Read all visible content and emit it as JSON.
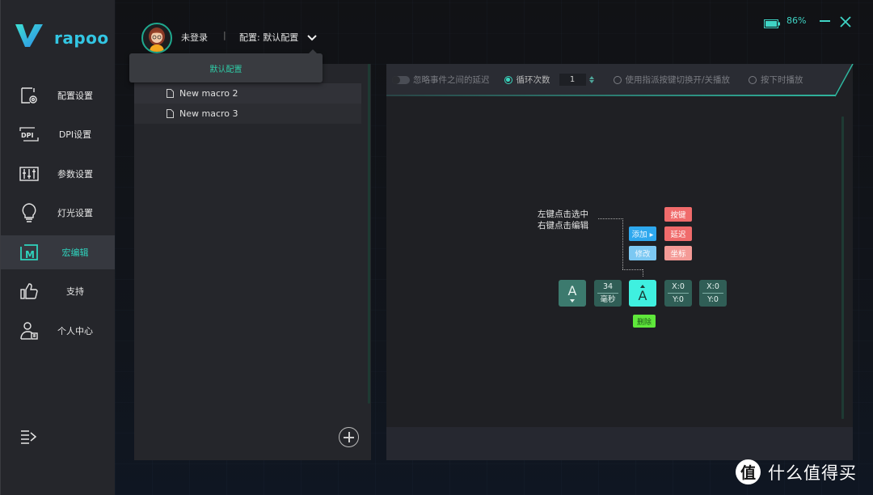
{
  "app": {
    "brand": "rapoo",
    "battery_percent": "86%",
    "battery_level": 0.86,
    "colors": {
      "accent": "#2fd3bd",
      "brand_blue": "#33c6e3",
      "battery": "#3fd4c5"
    }
  },
  "header": {
    "user_status": "未登录",
    "separator": "|",
    "config_label": "配置: 默认配置",
    "dropdown_options": [
      "默认配置"
    ]
  },
  "sidebar": {
    "items": [
      {
        "label": "配置设置",
        "icon": "profile-settings-icon",
        "active": false
      },
      {
        "label": "DPI设置",
        "icon": "dpi-icon",
        "active": false
      },
      {
        "label": "参数设置",
        "icon": "sliders-icon",
        "active": false
      },
      {
        "label": "灯光设置",
        "icon": "lightbulb-icon",
        "active": false
      },
      {
        "label": "宏编辑",
        "icon": "macro-icon",
        "active": true
      },
      {
        "label": "支持",
        "icon": "thumbs-up-icon",
        "active": false
      },
      {
        "label": "个人中心",
        "icon": "user-center-icon",
        "active": false
      }
    ]
  },
  "macros": {
    "items": [
      {
        "name": "New macro 2"
      },
      {
        "name": "New macro 3"
      }
    ]
  },
  "toolbar": {
    "ignore_delay_label": "忽略事件之间的延迟",
    "ignore_delay_on": false,
    "loop_label": "循环次数",
    "loop_count": "1",
    "toggle_play_label": "使用指派按键切换开/关播放",
    "hold_play_label": "按下时播放",
    "selected_mode": "loop"
  },
  "hint": {
    "line1": "左键点击选中",
    "line2": "右键点击编辑",
    "add_label": "添加 ▸",
    "modify_label": "修改",
    "key_label": "按键",
    "delay_label": "延迟",
    "coord_label": "坐标",
    "delete_label": "删除"
  },
  "macro_events": [
    {
      "type": "key-down",
      "key": "A"
    },
    {
      "type": "delay",
      "value": "34",
      "unit": "毫秒"
    },
    {
      "type": "key-up",
      "key": "A",
      "selected": true
    },
    {
      "type": "coord",
      "x": "X:0",
      "y": "Y:0"
    },
    {
      "type": "coord",
      "x": "X:0",
      "y": "Y:0"
    }
  ],
  "watermark": {
    "badge": "值",
    "text": "什么值得买"
  }
}
